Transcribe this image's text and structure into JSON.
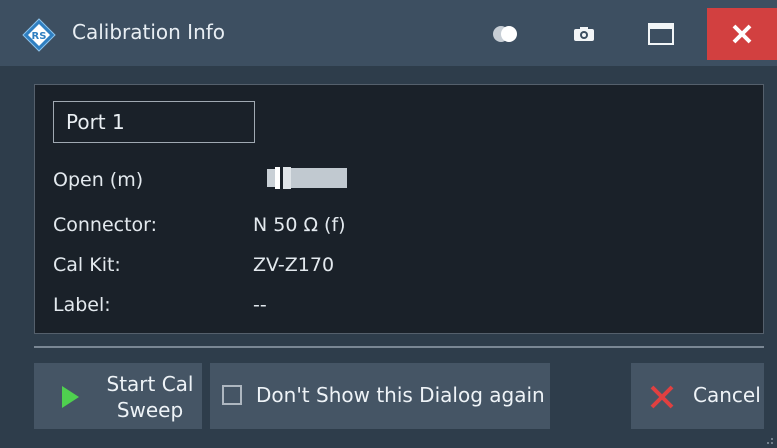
{
  "window": {
    "title": "Calibration Info",
    "colors": {
      "close": "#d24040",
      "play": "#4fd04f",
      "cancel_x": "#e04040",
      "titlebar": "#3d4f61"
    }
  },
  "titlebar_icons": [
    "rohde-schwarz-logo-icon",
    "toggle-icon",
    "camera-icon",
    "maximize-icon",
    "close-icon"
  ],
  "info": {
    "port": "Port 1",
    "standard": "Open (m)",
    "connector_label": "Connector:",
    "connector_value": "N 50 Ω (f)",
    "calkit_label": "Cal Kit:",
    "calkit_value": "ZV-Z170",
    "label_label": "Label:",
    "label_value": "--"
  },
  "buttons": {
    "start_cal": "Start Cal\nSweep",
    "dont_show": "Don't Show this Dialog again",
    "dont_show_checked": false,
    "cancel": "Cancel"
  }
}
